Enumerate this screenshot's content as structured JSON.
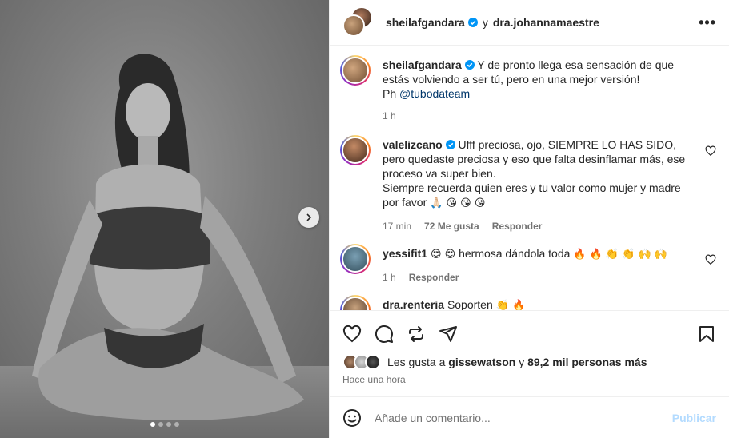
{
  "header": {
    "author": "sheilafgandara",
    "connector": "y",
    "collaborator": "dra.johannamaestre",
    "more_label": "•••"
  },
  "caption": {
    "username": "sheilafgandara",
    "text": "Y de pronto llega esa sensación de que estás volviendo a ser tú, pero en una mejor versión!",
    "credit_prefix": "Ph",
    "mention": "@tubodateam",
    "time": "1 h"
  },
  "comments": [
    {
      "username": "valelizcano",
      "text": "Ufff preciosa, ojo, SIEMPRE LO HAS SIDO, pero quedaste preciosa y eso que falta desinflamar más, ese proceso va super bien.",
      "text2": "Siempre recuerda quien eres y tu valor como mujer y madre por favor",
      "emojis": "🙏🏻 😘 😘 😘",
      "time": "17 min",
      "likes": "72 Me gusta",
      "reply": "Responder"
    },
    {
      "username": "yessifit1",
      "emojis_before": "😍 😍",
      "text": "hermosa dándola toda",
      "emojis_after": "🔥 🔥 👏 👏 🙌 🙌",
      "time": "1 h",
      "reply": "Responder"
    },
    {
      "username": "dra.renteria",
      "text": "Soporten",
      "emojis": "👏 🔥"
    }
  ],
  "likes": {
    "prefix": "Les gusta a",
    "user": "gissewatson",
    "connector": "y",
    "others": "89,2 mil personas más"
  },
  "timestamp": "Hace una hora",
  "add_comment": {
    "placeholder": "Añade un comentario...",
    "post_label": "Publicar"
  },
  "carousel": {
    "total": 4,
    "active": 0
  },
  "colors": {
    "link": "#00376b",
    "muted": "#737373",
    "post_disabled": "#b3dbff",
    "verified": "#0095f6"
  }
}
